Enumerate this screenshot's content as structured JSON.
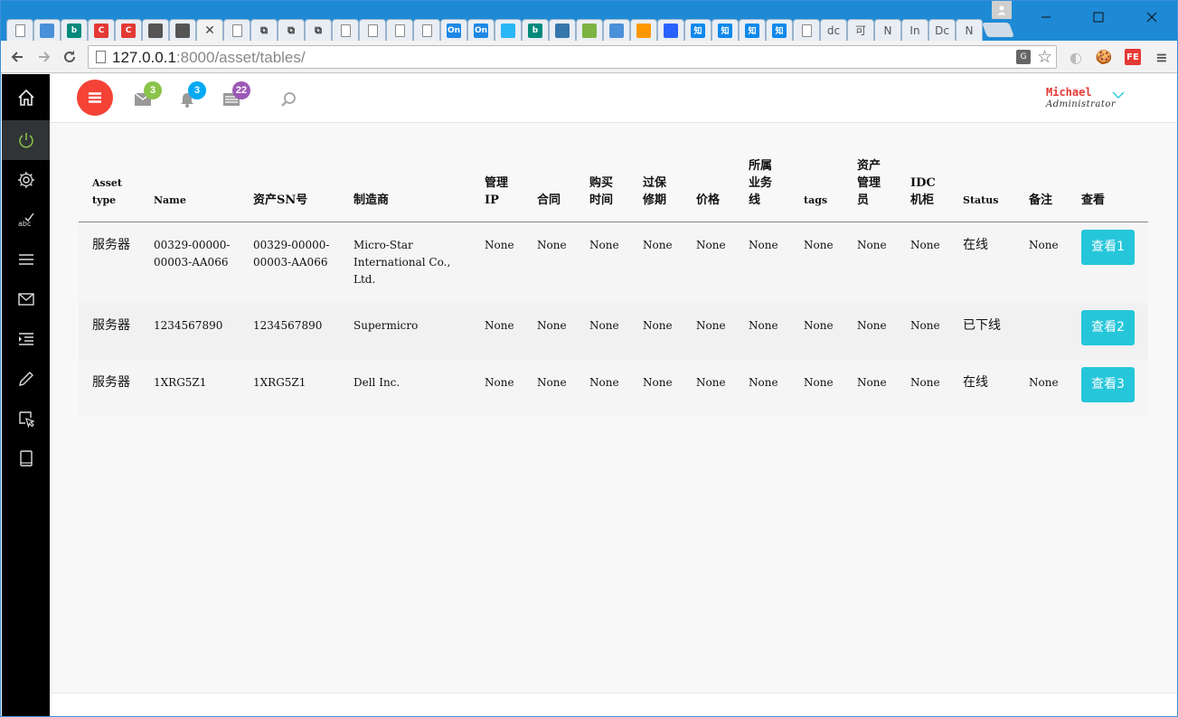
{
  "browser": {
    "url_host": "127.0.0.1",
    "url_rest": ":8000/asset/tables/",
    "tabs": [
      {
        "icon": "page",
        "label": ""
      },
      {
        "icon": "chrome",
        "label": ""
      },
      {
        "icon": "bing",
        "label": "b"
      },
      {
        "icon": "c-red",
        "label": "C"
      },
      {
        "icon": "c-red",
        "label": "C"
      },
      {
        "icon": "bars",
        "label": ""
      },
      {
        "icon": "bars",
        "label": ""
      },
      {
        "icon": "close",
        "label": "✕",
        "active": true
      },
      {
        "icon": "page",
        "label": ""
      },
      {
        "icon": "link",
        "label": ""
      },
      {
        "icon": "link",
        "label": ""
      },
      {
        "icon": "link",
        "label": ""
      },
      {
        "icon": "page",
        "label": ""
      },
      {
        "icon": "page",
        "label": ""
      },
      {
        "icon": "page",
        "label": ""
      },
      {
        "icon": "page",
        "label": ""
      },
      {
        "icon": "on",
        "label": "On"
      },
      {
        "icon": "on",
        "label": "On"
      },
      {
        "icon": "bili",
        "label": ""
      },
      {
        "icon": "bing",
        "label": "b"
      },
      {
        "icon": "python",
        "label": ""
      },
      {
        "icon": "multi",
        "label": ""
      },
      {
        "icon": "chrome",
        "label": ""
      },
      {
        "icon": "ubuntu",
        "label": ""
      },
      {
        "icon": "paw",
        "label": ""
      },
      {
        "icon": "zhi",
        "label": "知"
      },
      {
        "icon": "zhi",
        "label": "知"
      },
      {
        "icon": "zhi",
        "label": "知"
      },
      {
        "icon": "zhi",
        "label": "知"
      },
      {
        "icon": "page",
        "label": ""
      },
      {
        "icon": "text",
        "label": "dc"
      },
      {
        "icon": "text",
        "label": "可"
      },
      {
        "icon": "text",
        "label": "N"
      },
      {
        "icon": "text",
        "label": "In"
      },
      {
        "icon": "text",
        "label": "Dc"
      },
      {
        "icon": "text",
        "label": "N"
      }
    ]
  },
  "header": {
    "mail_count": "3",
    "bell_count": "3",
    "list_count": "22",
    "user_name": "Michael",
    "user_role": "Administrator"
  },
  "colors": {
    "menu_button": "#f44336",
    "mail_badge": "#8bc34a",
    "bell_badge": "#03a9f4",
    "list_badge": "#9c59b6",
    "view_button": "#26c6da"
  },
  "table": {
    "headers": [
      "Asset type",
      "Name",
      "资产SN号",
      "制造商",
      "管理IP",
      "合同",
      "购买时间",
      "过保修期",
      "价格",
      "所属业务线",
      "tags",
      "资产管理员",
      "IDC机柜",
      "Status",
      "备注",
      "查看"
    ],
    "rows": [
      {
        "type": "服务器",
        "name": "00329-00000-00003-AA066",
        "sn": "00329-00000-00003-AA066",
        "maker": "Micro-Star International Co., Ltd.",
        "ip": "None",
        "contract": "None",
        "buy": "None",
        "warranty": "None",
        "price": "None",
        "biz": "None",
        "tags": "None",
        "admin": "None",
        "idc": "None",
        "status": "在线",
        "memo": "None",
        "view": "查看1"
      },
      {
        "type": "服务器",
        "name": "1234567890",
        "sn": "1234567890",
        "maker": "Supermicro",
        "ip": "None",
        "contract": "None",
        "buy": "None",
        "warranty": "None",
        "price": "None",
        "biz": "None",
        "tags": "None",
        "admin": "None",
        "idc": "None",
        "status": "已下线",
        "memo": "",
        "view": "查看2"
      },
      {
        "type": "服务器",
        "name": "1XRG5Z1",
        "sn": "1XRG5Z1",
        "maker": "Dell Inc.",
        "ip": "None",
        "contract": "None",
        "buy": "None",
        "warranty": "None",
        "price": "None",
        "biz": "None",
        "tags": "None",
        "admin": "None",
        "idc": "None",
        "status": "在线",
        "memo": "None",
        "view": "查看3"
      }
    ]
  }
}
